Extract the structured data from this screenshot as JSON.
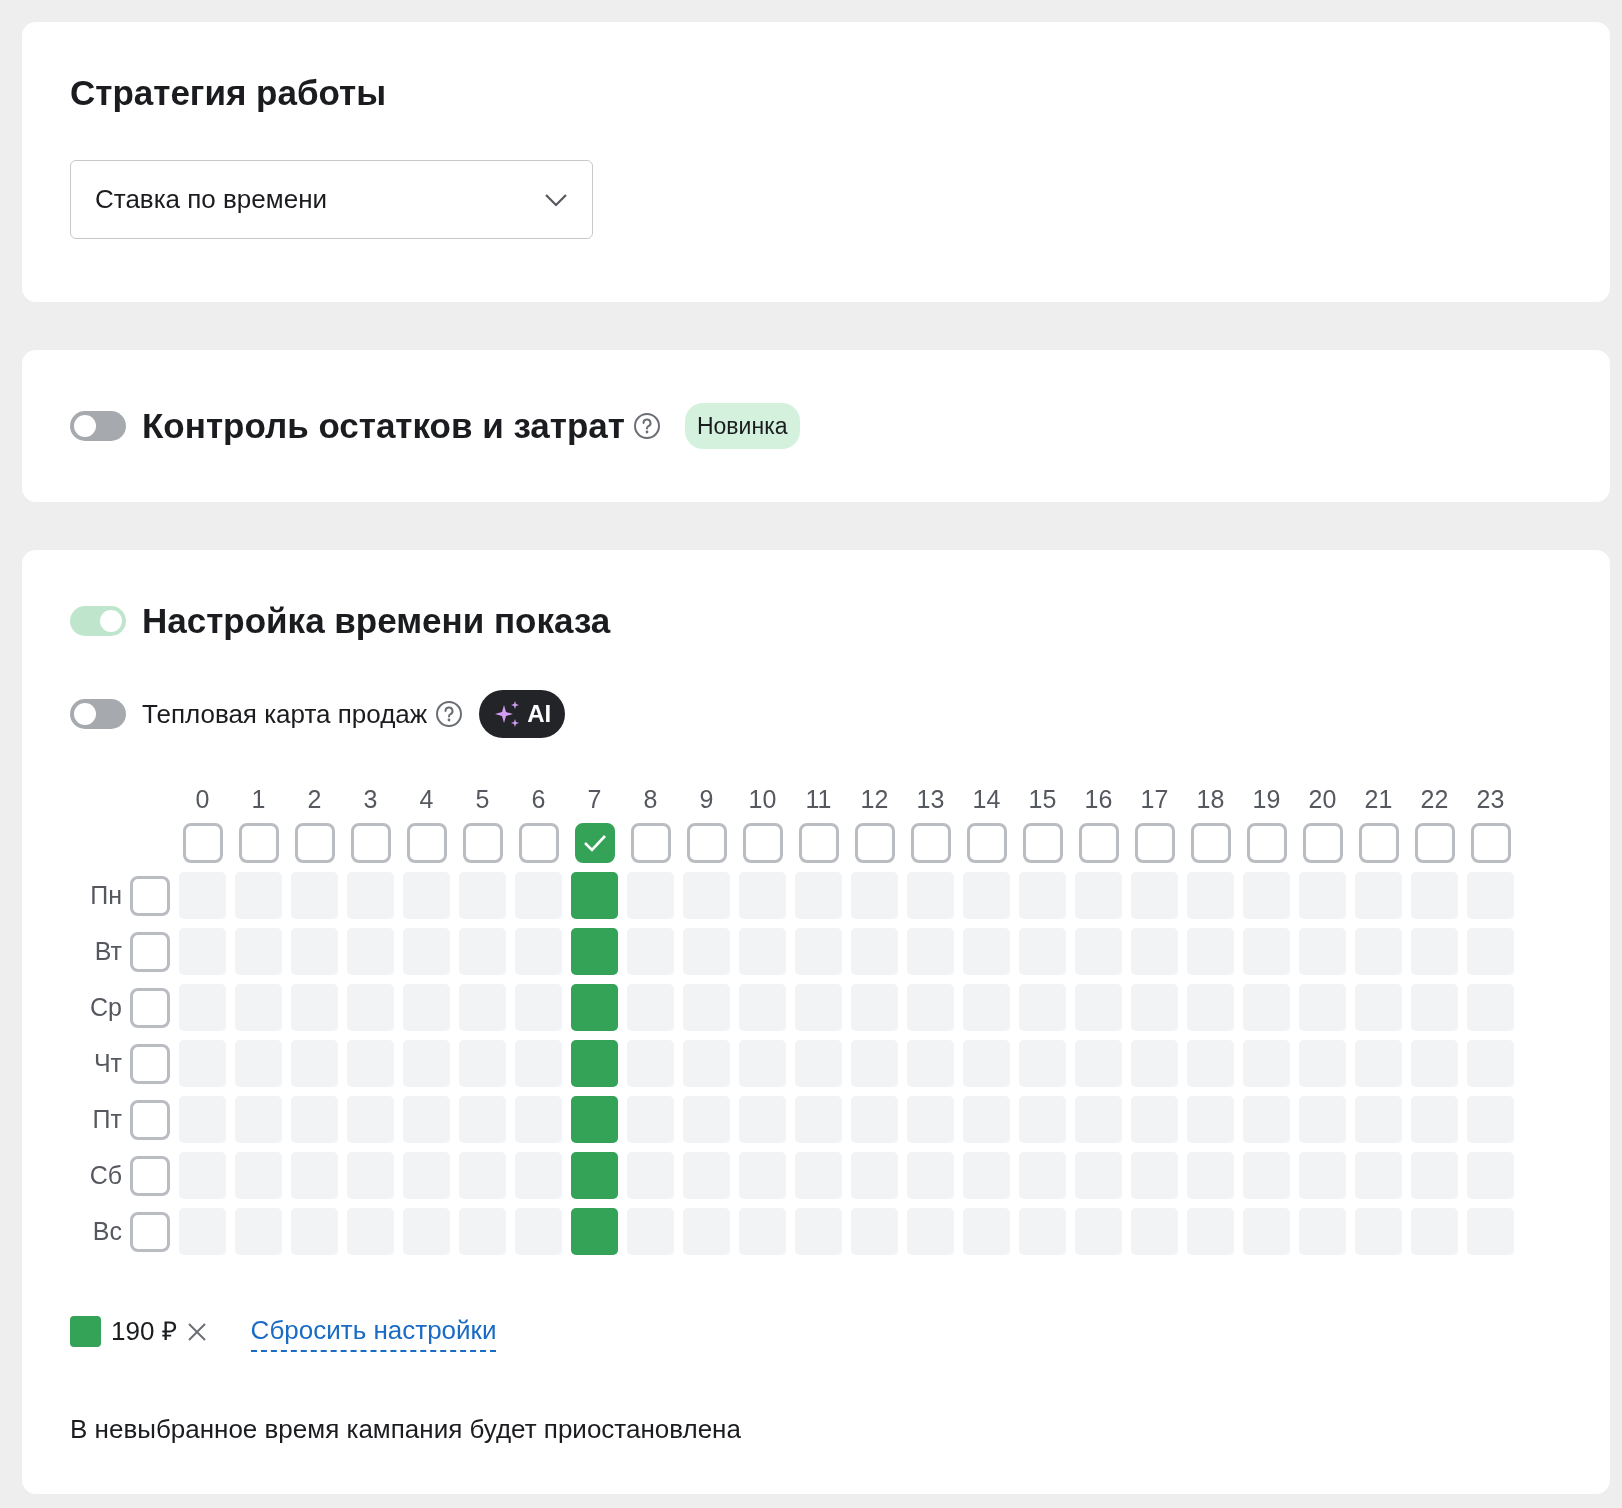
{
  "strategy": {
    "title": "Стратегия работы",
    "select_value": "Ставка по времени"
  },
  "budget_control": {
    "on": false,
    "title": "Контроль остатков и затрат",
    "badge": "Новинка"
  },
  "schedule": {
    "on": true,
    "title": "Настройка времени показа",
    "heatmap": {
      "on": false,
      "label": "Тепловая карта продаж",
      "badge": "AI"
    },
    "hours": [
      {
        "label": "0",
        "checked": false
      },
      {
        "label": "1",
        "checked": false
      },
      {
        "label": "2",
        "checked": false
      },
      {
        "label": "3",
        "checked": false
      },
      {
        "label": "4",
        "checked": false
      },
      {
        "label": "5",
        "checked": false
      },
      {
        "label": "6",
        "checked": false
      },
      {
        "label": "7",
        "checked": true
      },
      {
        "label": "8",
        "checked": false
      },
      {
        "label": "9",
        "checked": false
      },
      {
        "label": "10",
        "checked": false
      },
      {
        "label": "11",
        "checked": false
      },
      {
        "label": "12",
        "checked": false
      },
      {
        "label": "13",
        "checked": false
      },
      {
        "label": "14",
        "checked": false
      },
      {
        "label": "15",
        "checked": false
      },
      {
        "label": "16",
        "checked": false
      },
      {
        "label": "17",
        "checked": false
      },
      {
        "label": "18",
        "checked": false
      },
      {
        "label": "19",
        "checked": false
      },
      {
        "label": "20",
        "checked": false
      },
      {
        "label": "21",
        "checked": false
      },
      {
        "label": "22",
        "checked": false
      },
      {
        "label": "23",
        "checked": false
      }
    ],
    "days": [
      {
        "label": "Пн",
        "checked": false,
        "cells": [
          false,
          false,
          false,
          false,
          false,
          false,
          false,
          true,
          false,
          false,
          false,
          false,
          false,
          false,
          false,
          false,
          false,
          false,
          false,
          false,
          false,
          false,
          false,
          false
        ]
      },
      {
        "label": "Вт",
        "checked": false,
        "cells": [
          false,
          false,
          false,
          false,
          false,
          false,
          false,
          true,
          false,
          false,
          false,
          false,
          false,
          false,
          false,
          false,
          false,
          false,
          false,
          false,
          false,
          false,
          false,
          false
        ]
      },
      {
        "label": "Ср",
        "checked": false,
        "cells": [
          false,
          false,
          false,
          false,
          false,
          false,
          false,
          true,
          false,
          false,
          false,
          false,
          false,
          false,
          false,
          false,
          false,
          false,
          false,
          false,
          false,
          false,
          false,
          false
        ]
      },
      {
        "label": "Чт",
        "checked": false,
        "cells": [
          false,
          false,
          false,
          false,
          false,
          false,
          false,
          true,
          false,
          false,
          false,
          false,
          false,
          false,
          false,
          false,
          false,
          false,
          false,
          false,
          false,
          false,
          false,
          false
        ]
      },
      {
        "label": "Пт",
        "checked": false,
        "cells": [
          false,
          false,
          false,
          false,
          false,
          false,
          false,
          true,
          false,
          false,
          false,
          false,
          false,
          false,
          false,
          false,
          false,
          false,
          false,
          false,
          false,
          false,
          false,
          false
        ]
      },
      {
        "label": "Сб",
        "checked": false,
        "cells": [
          false,
          false,
          false,
          false,
          false,
          false,
          false,
          true,
          false,
          false,
          false,
          false,
          false,
          false,
          false,
          false,
          false,
          false,
          false,
          false,
          false,
          false,
          false,
          false
        ]
      },
      {
        "label": "Вс",
        "checked": false,
        "cells": [
          false,
          false,
          false,
          false,
          false,
          false,
          false,
          true,
          false,
          false,
          false,
          false,
          false,
          false,
          false,
          false,
          false,
          false,
          false,
          false,
          false,
          false,
          false,
          false
        ]
      }
    ],
    "legend": {
      "color": "#34a257",
      "label": "190 ₽"
    },
    "reset_link": "Сбросить настройки",
    "note": "В невыбранное время кампания будет приостановлена"
  }
}
